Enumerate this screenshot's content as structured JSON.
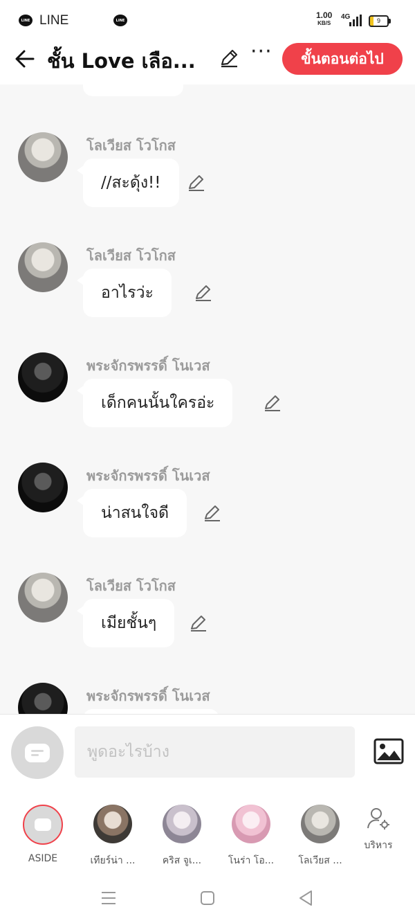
{
  "status_bar": {
    "app_name": "LINE",
    "net_speed": "1.00",
    "net_unit": "KB/S",
    "net_type": "4G",
    "battery": "9"
  },
  "header": {
    "title": "ชั้น Love เลือ...",
    "next_label": "ขั้นตอนต่อไป",
    "more_label": "···"
  },
  "messages": [
    {
      "sender": "โลเวียส โวโกส",
      "text": "//สะดุ้ง!!",
      "avatar": "lovias"
    },
    {
      "sender": "โลเวียส โวโกส",
      "text": "อาไรว่ะ",
      "avatar": "lovias"
    },
    {
      "sender": "พระจักรพรรดิ์ โนเวส",
      "text": "เด็กคนนั้นใครอ่ะ",
      "avatar": "emperor"
    },
    {
      "sender": "พระจักรพรรดิ์ โนเวส",
      "text": "น่าสนใจดี",
      "avatar": "emperor"
    },
    {
      "sender": "โลเวียส โวโกส",
      "text": "เมียชั้นๆ",
      "avatar": "lovias"
    },
    {
      "sender": "พระจักรพรรดิ์ โนเวส",
      "text": "",
      "avatar": "emperor"
    }
  ],
  "input": {
    "placeholder": "พูดอะไรบ้าง"
  },
  "characters": [
    {
      "label": "ASIDE"
    },
    {
      "label": "เทียร์น่า ..."
    },
    {
      "label": "คริส จูเ..."
    },
    {
      "label": "โนร่า โอ..."
    },
    {
      "label": "โลเวียส ..."
    }
  ],
  "manage_label": "บริหาร",
  "colors": {
    "accent": "#f0414a",
    "background": "#f7f7f7",
    "sender_name": "#9b9b9b"
  }
}
